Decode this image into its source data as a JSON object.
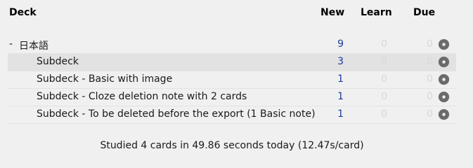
{
  "header": {
    "deck": "Deck",
    "new": "New",
    "learn": "Learn",
    "due": "Due"
  },
  "decks": [
    {
      "collapse": "-",
      "name": "日本語",
      "new": "9",
      "learn": "0",
      "due": "0",
      "level": "top",
      "icon": "gear-icon"
    },
    {
      "collapse": "",
      "name": "Subdeck",
      "new": "3",
      "learn": "0",
      "due": "0",
      "level": "sub",
      "current": true,
      "icon": "gear-icon"
    },
    {
      "collapse": "",
      "name": "Subdeck - Basic with image",
      "new": "1",
      "learn": "0",
      "due": "0",
      "level": "sub",
      "icon": "gear-icon"
    },
    {
      "collapse": "",
      "name": "Subdeck - Cloze deletion note with 2 cards",
      "new": "1",
      "learn": "0",
      "due": "0",
      "level": "sub",
      "icon": "gear-icon"
    },
    {
      "collapse": "",
      "name": "Subdeck - To be deleted before the export (1 Basic note)",
      "new": "1",
      "learn": "0",
      "due": "0",
      "level": "sub",
      "icon": "gear-icon"
    }
  ],
  "stats": {
    "text": "Studied 4 cards in 49.86 seconds today (12.47s/card)"
  },
  "colors": {
    "background": "#f0f0f0",
    "new_count": "#1e3a9c",
    "zero_count": "#d8d8d8",
    "current_row": "#e2e2e2",
    "gear": "#6b6b6b"
  }
}
